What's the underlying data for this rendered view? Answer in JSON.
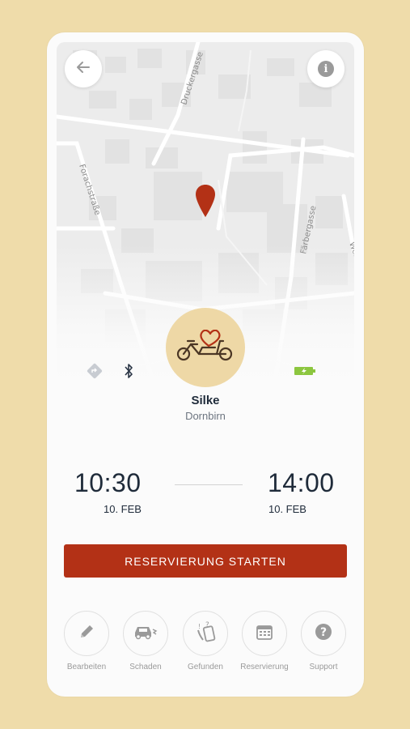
{
  "map": {
    "street_labels": [
      "Druckergasse",
      "Forachstraße",
      "Färbergasse",
      "Weh"
    ]
  },
  "header": {
    "back_icon": "arrow-left-icon",
    "info_icon": "info-icon"
  },
  "bike": {
    "name": "Silke",
    "location": "Dornbirn",
    "icon": "cargo-bike-heart-icon"
  },
  "status_icons": {
    "navigation": "navigation-diamond-icon",
    "bluetooth": "bluetooth-icon",
    "battery": "battery-charging-icon",
    "battery_color": "#8cc63f"
  },
  "reservation": {
    "start_time": "10:30",
    "start_date": "10. FEB",
    "end_time": "14:00",
    "end_date": "10. FEB"
  },
  "start_button": {
    "label": "RESERVIERUNG STARTEN",
    "color": "#b33116"
  },
  "actions": [
    {
      "label": "Bearbeiten",
      "icon": "pencil-icon"
    },
    {
      "label": "Schaden",
      "icon": "car-damage-icon"
    },
    {
      "label": "Gefunden",
      "icon": "found-phone-icon"
    },
    {
      "label": "Reservierung",
      "icon": "calendar-icon"
    },
    {
      "label": "Support",
      "icon": "question-icon"
    }
  ],
  "colors": {
    "background": "#efdcaa",
    "avatar_bg": "#eed8a6",
    "pin": "#b33116"
  }
}
